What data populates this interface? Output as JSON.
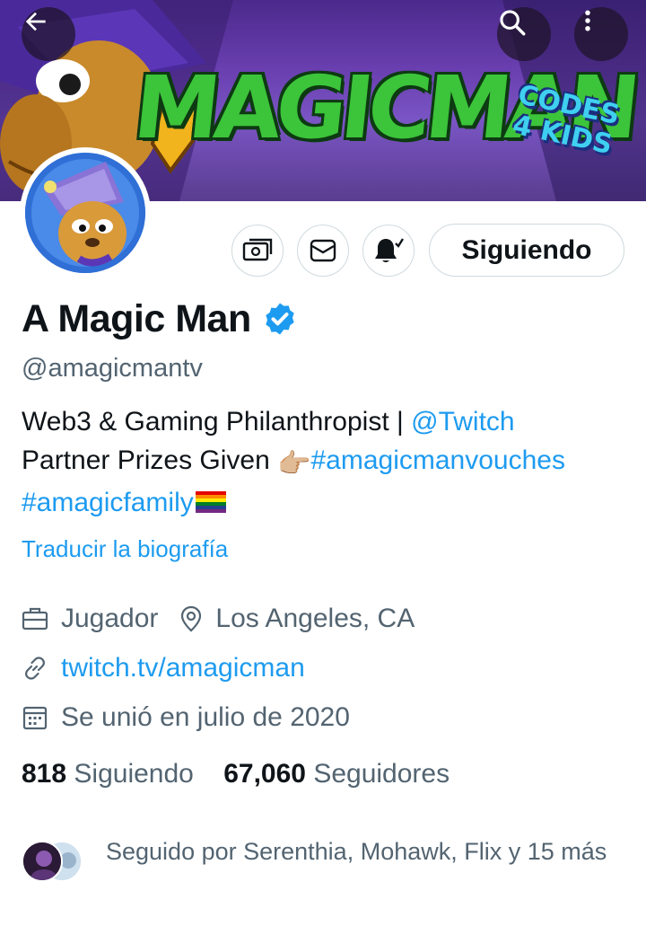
{
  "banner": {
    "title_art": "MAGICMAN",
    "badge_line1": "CODES",
    "badge_line2": "4 KIDS"
  },
  "header": {
    "back_icon": "arrow-left-icon",
    "search_icon": "search-icon",
    "more_icon": "more-vertical-icon"
  },
  "actions": {
    "follow_label": "Siguiendo"
  },
  "profile": {
    "display_name": "A Magic Man",
    "handle": "@amagicmantv",
    "bio": {
      "line1_text": "Web3 & Gaming Philanthropist | ",
      "line1_link": "@Twitch",
      "line2_text": "Partner Prizes Given ",
      "line2_emoji": "👉🏼",
      "line2_link": "#amagicmanvouches",
      "line3_link": "#amagicfamily",
      "line3_emoji": "🏳️‍🌈"
    },
    "translate_label": "Traducir la biografía",
    "category": "Jugador",
    "location": "Los Angeles, CA",
    "website": "twitch.tv/amagicman",
    "joined": "Se unió en julio de 2020"
  },
  "stats": {
    "following_count": "818",
    "following_label": "Siguiendo",
    "followers_count": "67,060",
    "followers_label": "Seguidores"
  },
  "followed_by": {
    "text": "Seguido por Serenthia, Mohawk, Flix y 15 más"
  },
  "colors": {
    "accent": "#1d9bf0",
    "secondary_text": "#536471",
    "primary_text": "#0f1419",
    "border": "#cfd9de"
  }
}
